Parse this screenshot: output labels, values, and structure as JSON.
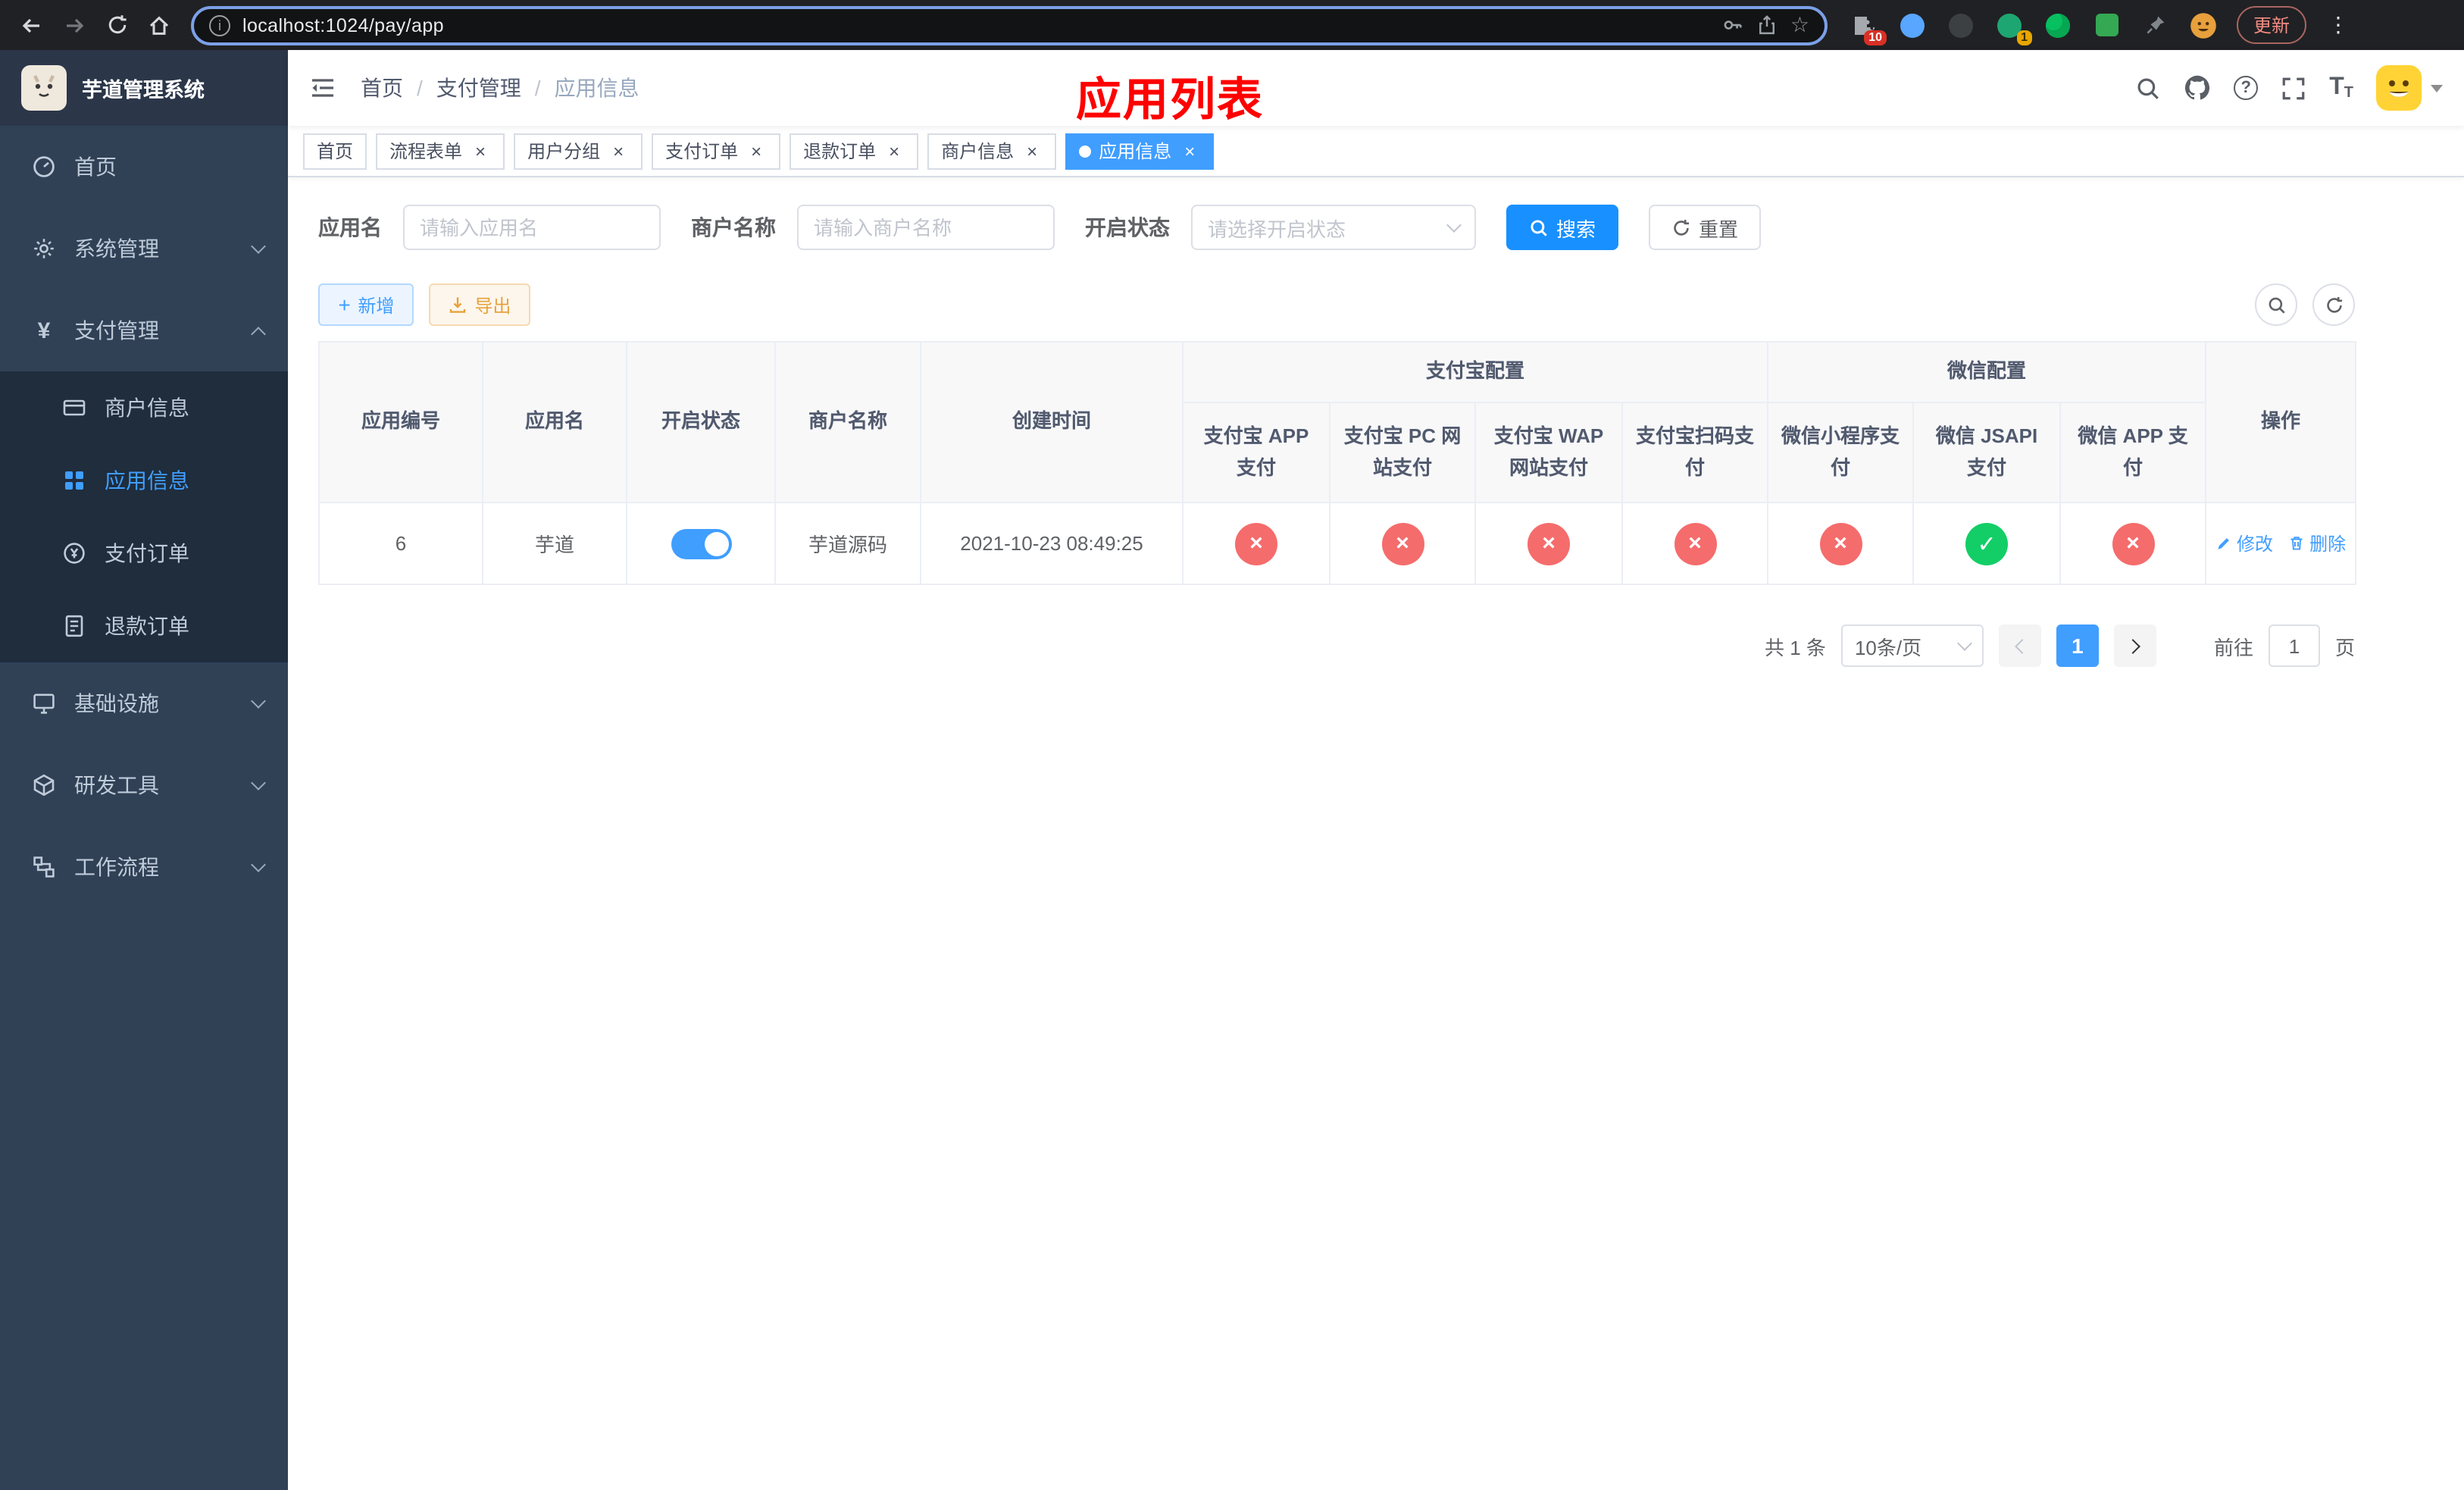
{
  "browser": {
    "url": "localhost:1024/pay/app",
    "update_button": "更新",
    "extensions_badge": "10",
    "extension_badge": "1"
  },
  "sidebar": {
    "app_title": "芋道管理系统",
    "home": "首页",
    "system": "系统管理",
    "payment": "支付管理",
    "merchant_info": "商户信息",
    "app_info": "应用信息",
    "pay_order": "支付订单",
    "refund_order": "退款订单",
    "infrastructure": "基础设施",
    "dev_tools": "研发工具",
    "workflow": "工作流程"
  },
  "navbar": {
    "breadcrumb_home": "首页",
    "breadcrumb_section": "支付管理",
    "breadcrumb_current": "应用信息",
    "annotation": "应用列表"
  },
  "tabs": {
    "home": "首页",
    "process_form": "流程表单",
    "user_group": "用户分组",
    "pay_order": "支付订单",
    "refund_order": "退款订单",
    "merchant_info": "商户信息",
    "app_info": "应用信息"
  },
  "filters": {
    "app_name_label": "应用名",
    "app_name_placeholder": "请输入应用名",
    "merchant_label": "商户名称",
    "merchant_placeholder": "请输入商户名称",
    "status_label": "开启状态",
    "status_placeholder": "请选择开启状态",
    "search": "搜索",
    "reset": "重置"
  },
  "toolbar": {
    "add": "新增",
    "export": "导出"
  },
  "table": {
    "columns": {
      "app_id": "应用编号",
      "app_name": "应用名",
      "status": "开启状态",
      "merchant_name": "商户名称",
      "create_time": "创建时间",
      "alipay_group": "支付宝配置",
      "wechat_group": "微信配置",
      "alipay_app": "支付宝 APP 支付",
      "alipay_pc": "支付宝 PC 网站支付",
      "alipay_wap": "支付宝 WAP 网站支付",
      "alipay_qr": "支付宝扫码支付",
      "wx_lite": "微信小程序支付",
      "wx_jsapi": "微信 JSAPI 支付",
      "wx_app": "微信 APP 支付",
      "actions": "操作"
    },
    "row": {
      "app_id": "6",
      "app_name": "芋道",
      "status_enabled": true,
      "merchant_name": "芋道源码",
      "create_time": "2021-10-23 08:49:25",
      "configs": {
        "alipay_app": false,
        "alipay_pc": false,
        "alipay_wap": false,
        "alipay_qr": false,
        "wx_lite": false,
        "wx_jsapi": true,
        "wx_app": false
      },
      "edit": "修改",
      "delete": "删除"
    }
  },
  "pagination": {
    "total": "共 1 条",
    "page_size": "10条/页",
    "page": "1",
    "goto": "前往",
    "goto_value": "1",
    "unit": "页"
  },
  "colors": {
    "primary": "#409eff",
    "search_button": "#1890ff",
    "danger_badge": "#f56c6c",
    "success_badge": "#13ce66",
    "sidebar_bg": "#304156",
    "submenu_bg": "#1f2d3d",
    "annotation_red": "#fe0000",
    "warning": "#e6a23c"
  },
  "icons": {
    "back-icon": "left arrow",
    "forward-icon": "right arrow",
    "reload-icon": "circular arrow",
    "home-icon": "house",
    "site-info-icon": "circled i",
    "password-key-icon": "key",
    "share-icon": "box with up arrow",
    "bookmark-star-icon": "star",
    "extensions-puzzle-icon": "puzzle piece",
    "search-icon": "magnifier",
    "github-icon": "octocat",
    "help-icon": "circled question mark",
    "fullscreen-icon": "expand corners",
    "font-size-icon": "double T",
    "dashboard-icon": "gauge",
    "gear-icon": "gear",
    "yen-icon": "yen sign",
    "card-icon": "bank card",
    "grid-icon": "app grid",
    "coin-icon": "circled yen",
    "document-icon": "document",
    "monitor-icon": "monitor",
    "cube-icon": "cube",
    "flow-icon": "flow nodes",
    "check-icon": "check mark",
    "cross-icon": "cross mark",
    "edit-icon": "pencil",
    "delete-icon": "trash can"
  }
}
